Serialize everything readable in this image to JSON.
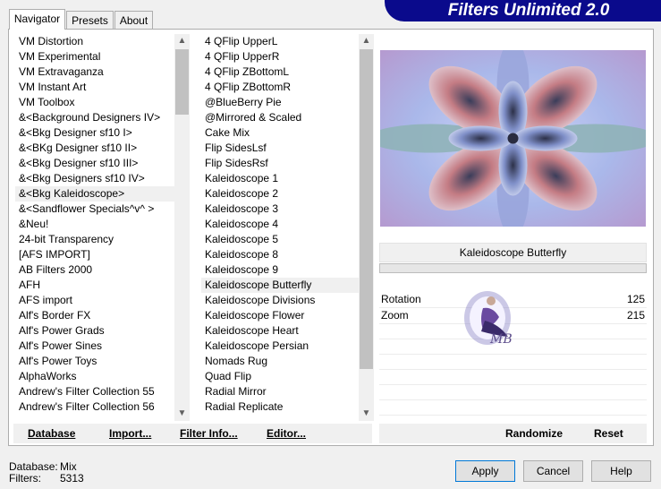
{
  "tabs": [
    "Navigator",
    "Presets",
    "About"
  ],
  "banner_title": "Filters Unlimited 2.0",
  "categories": [
    "VM Distortion",
    "VM Experimental",
    "VM Extravaganza",
    "VM Instant Art",
    "VM Toolbox",
    "&<Background Designers IV>",
    "&<Bkg Designer sf10 I>",
    "&<BKg Designer sf10 II>",
    "&<Bkg Designer sf10 III>",
    "&<Bkg Designers sf10 IV>",
    "&<Bkg Kaleidoscope>",
    "&<Sandflower Specials^v^ >",
    "&Neu!",
    "24-bit Transparency",
    "[AFS IMPORT]",
    "AB Filters 2000",
    "AFH",
    "AFS import",
    "Alf's Border FX",
    "Alf's Power Grads",
    "Alf's Power Sines",
    "Alf's Power Toys",
    "AlphaWorks",
    "Andrew's Filter Collection 55",
    "Andrew's Filter Collection 56"
  ],
  "categories_selected": 10,
  "filters": [
    "4 QFlip UpperL",
    "4 QFlip UpperR",
    "4 QFlip ZBottomL",
    "4 QFlip ZBottomR",
    "@BlueBerry Pie",
    "@Mirrored & Scaled",
    "Cake Mix",
    "Flip SidesLsf",
    "Flip SidesRsf",
    "Kaleidoscope 1",
    "Kaleidoscope 2",
    "Kaleidoscope 3",
    "Kaleidoscope 4",
    "Kaleidoscope 5",
    "Kaleidoscope 8",
    "Kaleidoscope 9",
    "Kaleidoscope Butterfly",
    "Kaleidoscope Divisions",
    "Kaleidoscope Flower",
    "Kaleidoscope Heart",
    "Kaleidoscope Persian",
    "Nomads Rug",
    "Quad Flip",
    "Radial Mirror",
    "Radial Replicate"
  ],
  "filters_selected": 16,
  "left_buttons": {
    "database": "Database",
    "import": "Import...",
    "filter_info": "Filter Info...",
    "editor": "Editor..."
  },
  "filter_name": "Kaleidoscope Butterfly",
  "params": [
    {
      "label": "Rotation",
      "value": "125"
    },
    {
      "label": "Zoom",
      "value": "215"
    }
  ],
  "right_buttons": {
    "randomize": "Randomize",
    "reset": "Reset"
  },
  "footer": {
    "database_label": "Database:",
    "database_value": "Mix",
    "filters_label": "Filters:",
    "filters_value": "5313"
  },
  "dialog_buttons": {
    "apply": "Apply",
    "cancel": "Cancel",
    "help": "Help"
  },
  "watermark_text": "MB",
  "colors": {
    "banner": "#0a0a8c",
    "selection": "#f0f0f0",
    "scroll_thumb": "#c1c1c1"
  }
}
